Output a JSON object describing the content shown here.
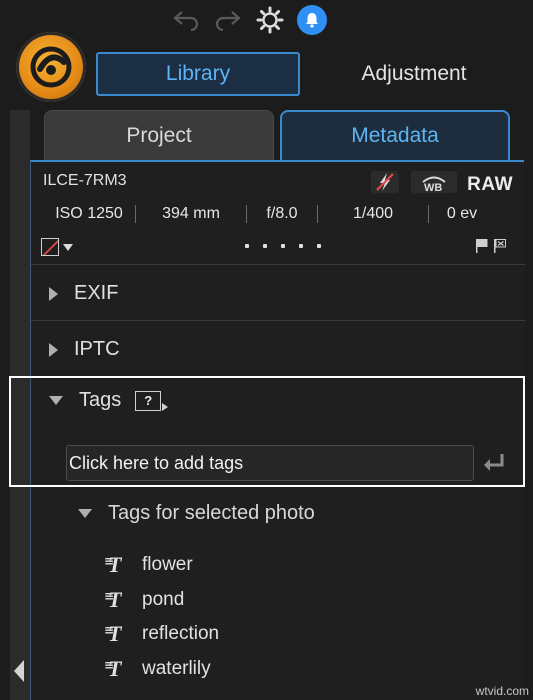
{
  "toolbar": {
    "undo_icon": "undo-arrow-icon",
    "redo_icon": "redo-arrow-icon",
    "settings_icon": "gear-icon",
    "notifications_icon": "bell-icon"
  },
  "app": {
    "logo_icon": "app-logo",
    "accent_color": "#3b8ad0",
    "logo_color": "#e48a16"
  },
  "mode_tabs": [
    {
      "label": "Library",
      "active": true
    },
    {
      "label": "Adjustment",
      "active": false
    }
  ],
  "sub_tabs": [
    {
      "label": "Project",
      "active": false
    },
    {
      "label": "Metadata",
      "active": true
    }
  ],
  "camera": {
    "model": "ILCE-7RM3",
    "flash_icon": "flash-off-icon",
    "wb_icon": "white-balance-icon",
    "format": "RAW"
  },
  "exposure": {
    "iso": "ISO 1250",
    "focal_length": "394 mm",
    "aperture": "f/8.0",
    "shutter": "1/400",
    "ev": "0 ev"
  },
  "rating": {
    "stars": 0,
    "max_stars": 5,
    "color_label": "none"
  },
  "sections": {
    "exif": {
      "label": "EXIF",
      "expanded": false
    },
    "iptc": {
      "label": "IPTC",
      "expanded": false
    },
    "tags": {
      "label": "Tags",
      "expanded": true,
      "help_badge": "?"
    }
  },
  "tag_input": {
    "placeholder": "Click here to add tags"
  },
  "selected_tags": {
    "header": "Tags for selected photo",
    "items": [
      "flower",
      "pond",
      "reflection",
      "waterlily"
    ]
  },
  "watermark": "wtvid.com"
}
